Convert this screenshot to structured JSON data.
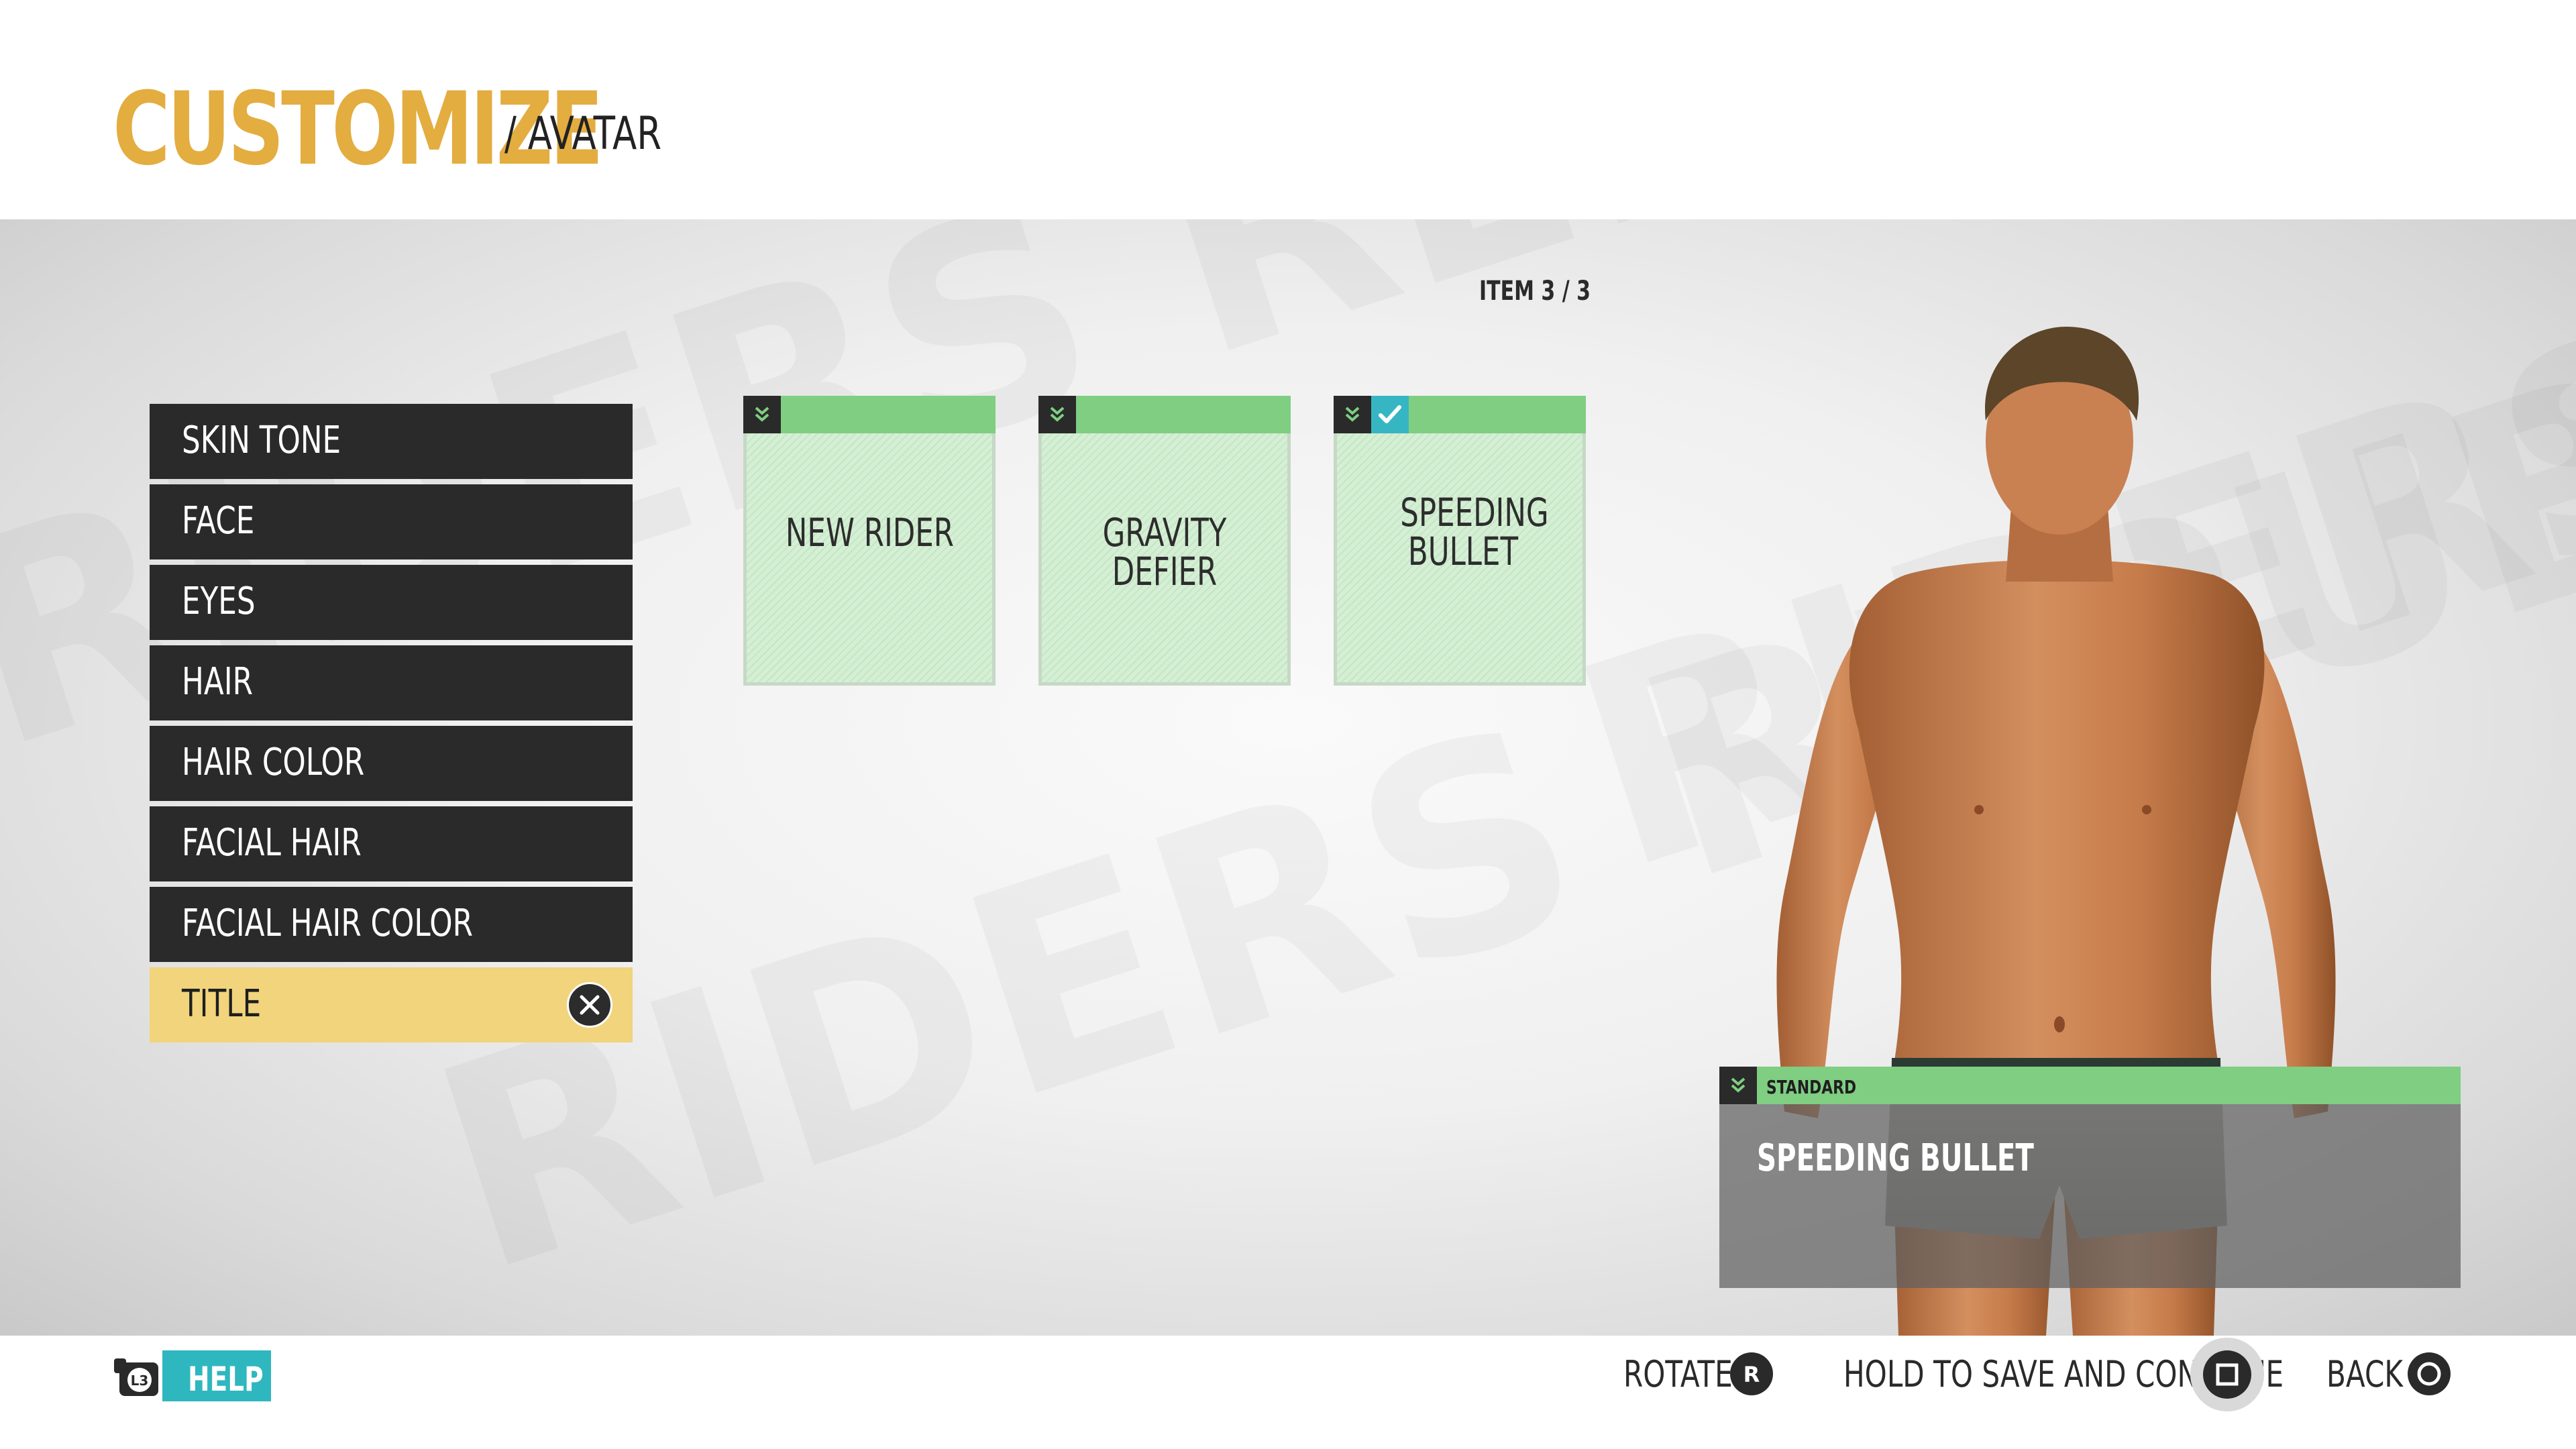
{
  "header": {
    "title": "CUSTOMIZE",
    "subtitle": "/ AVATAR"
  },
  "menu": {
    "items": [
      {
        "label": "SKIN TONE"
      },
      {
        "label": "FACE"
      },
      {
        "label": "EYES"
      },
      {
        "label": "HAIR"
      },
      {
        "label": "HAIR COLOR"
      },
      {
        "label": "FACIAL HAIR"
      },
      {
        "label": "FACIAL HAIR COLOR"
      },
      {
        "label": "TITLE",
        "active": true
      }
    ]
  },
  "grid": {
    "counter": "ITEM 3 / 3"
  },
  "cards": [
    {
      "label": "NEW RIDER",
      "selected": false
    },
    {
      "label": "GRAVITY DEFIER",
      "selected": false
    },
    {
      "label": "SPEEDING BULLET",
      "selected": true
    }
  ],
  "info": {
    "tier": "STANDARD",
    "name": "SPEEDING BULLET"
  },
  "footer": {
    "help_label": "HELP",
    "help_key": "L3",
    "rotate_label": "ROTATE",
    "rotate_key": "R",
    "save_label": "HOLD TO SAVE AND CONTINUE",
    "back_label": "BACK"
  },
  "colors": {
    "accent_title": "#e3ad40",
    "menu_active": "#f1d47c",
    "tier_green": "#7fce82",
    "help_teal": "#2fb7bf",
    "check_teal": "#36b6c3"
  },
  "icons": [
    "chevron-down-icon",
    "check-icon",
    "close-icon",
    "controller-icon",
    "r-stick-icon",
    "square-button-icon",
    "circle-button-icon"
  ]
}
